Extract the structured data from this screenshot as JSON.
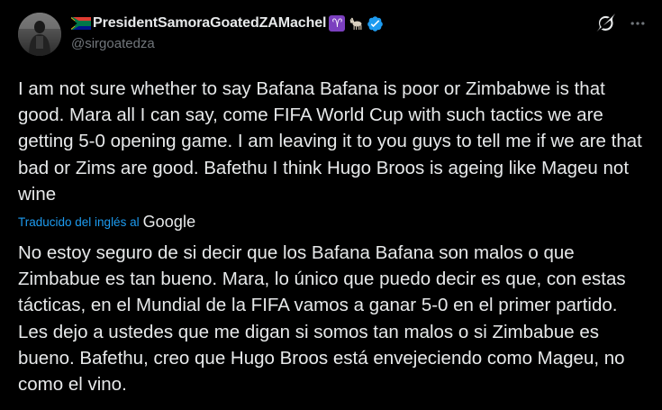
{
  "author": {
    "display_name": "PresidentSamoraGoatedZAMachel",
    "handle": "@sirgoatedza",
    "zodiac_badge": "♈",
    "icons": [
      "south-africa-flag-icon",
      "aries-icon",
      "goat-icon",
      "verified-badge-icon"
    ]
  },
  "actions": {
    "grok_icon": "grok-icon",
    "more_icon": "more-icon"
  },
  "tweet": {
    "text": "I am not sure whether to say Bafana Bafana is poor or Zimbabwe is that good. Mara all I can say, come FIFA World Cup with such tactics we are getting 5-0 opening game. I am leaving it to you guys to tell me if we are that bad or Zims are good. Bafethu I think Hugo Broos is ageing like Mageu not wine"
  },
  "translation": {
    "label": "Traducido del inglés al",
    "provider": "Google",
    "text": "No estoy seguro de si decir que los Bafana Bafana son malos o que Zimbabue es tan bueno. Mara, lo único que puedo decir es que, con estas tácticas, en el Mundial de la FIFA vamos a ganar 5-0 en el primer partido. Les dejo a ustedes que me digan si somos tan malos o si Zimbabue es bueno. Bafethu, creo que Hugo Broos está envejeciendo como Mageu, no como el vino."
  },
  "colors": {
    "background": "#000000",
    "text_primary": "#e7e9ea",
    "text_secondary": "#71767b",
    "accent_blue": "#1d9bf0",
    "aries_purple": "#7b3fbf"
  }
}
